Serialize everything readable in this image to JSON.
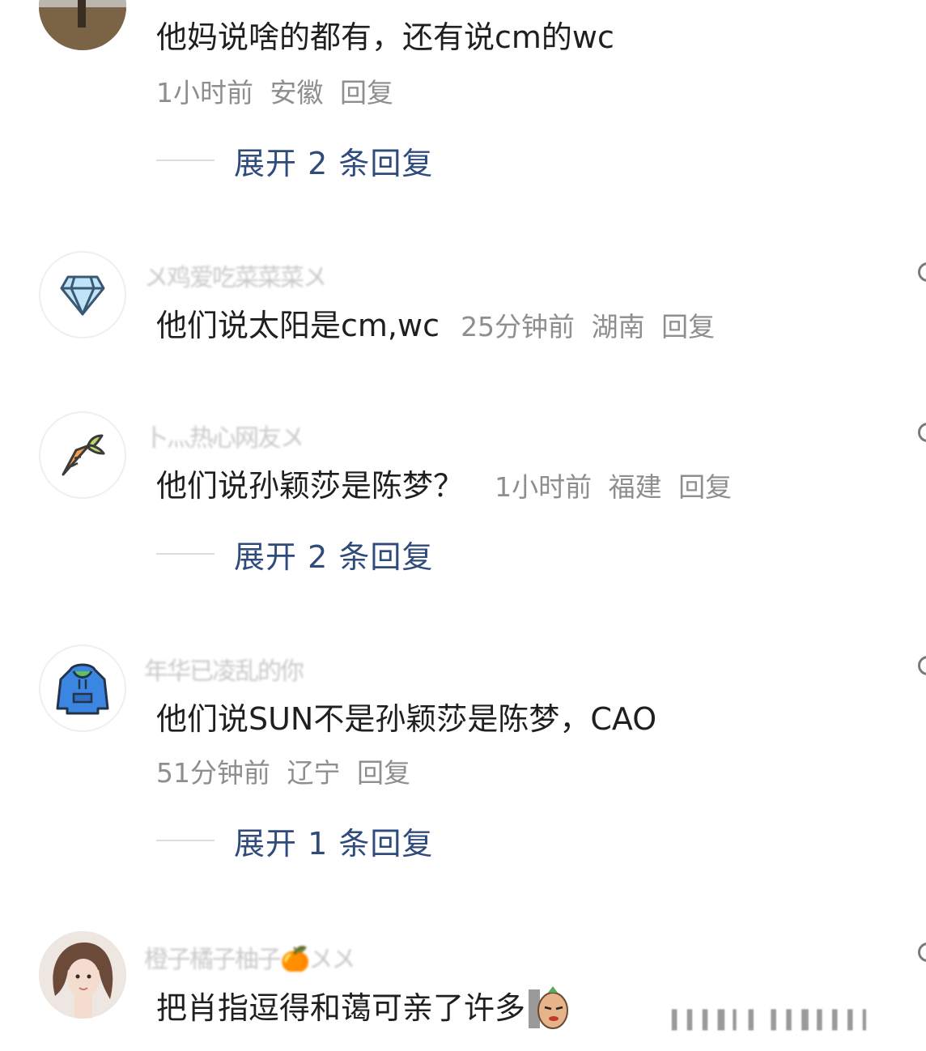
{
  "comments": [
    {
      "text": "他妈说啥的都有，还有说cm的wc",
      "time": "1小时前",
      "region": "安徽",
      "reply": "回复",
      "expand": "展开 2 条回复"
    },
    {
      "username": "〤鸡爱吃菜菜菜〤",
      "avatar_icon": "diamond-icon",
      "text": "他们说太阳是cm,wc",
      "time": "25分钟前",
      "region": "湖南",
      "reply": "回复"
    },
    {
      "username": "卜灬热心网友〤",
      "avatar_icon": "carrot-icon",
      "text": "他们说孙颖莎是陈梦？",
      "time": "1小时前",
      "region": "福建",
      "reply": "回复",
      "expand": "展开 2 条回复"
    },
    {
      "username": "年华已凌乱的你",
      "avatar_icon": "hoodie-icon",
      "text": "他们说SUN不是孙颖莎是陈梦，CAO",
      "time": "51分钟前",
      "region": "辽宁",
      "reply": "回复",
      "expand": "展开 1 条回复"
    },
    {
      "username": "橙子橘子柚子🍊〤〤",
      "avatar_icon": "girl-avatar",
      "text": "把肖指逗得和蔼可亲了许多",
      "sticker": "potato-sticker-icon"
    }
  ],
  "colors": {
    "text": "#1f1f1f",
    "meta": "#8e8e8e",
    "expand": "#2f4b7c"
  }
}
